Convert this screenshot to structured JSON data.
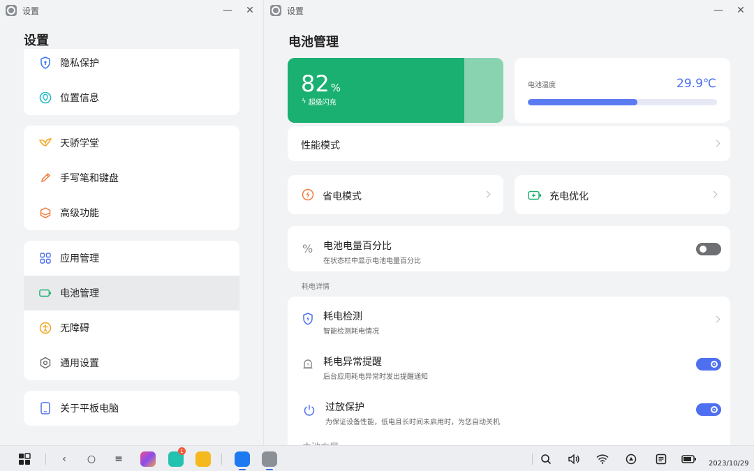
{
  "left_window": {
    "title": "设置",
    "page_title": "设置",
    "groups": [
      {
        "items": [
          {
            "label": "隐私保护",
            "icon": "shield-icon"
          },
          {
            "label": "位置信息",
            "icon": "location-icon"
          }
        ]
      },
      {
        "items": [
          {
            "label": "天骄学堂",
            "icon": "bird-icon"
          },
          {
            "label": "手写笔和键盘",
            "icon": "pen-icon"
          },
          {
            "label": "高级功能",
            "icon": "cube-icon"
          }
        ]
      },
      {
        "items": [
          {
            "label": "应用管理",
            "icon": "apps-grid-icon"
          },
          {
            "label": "电池管理",
            "icon": "battery-icon",
            "selected": true
          },
          {
            "label": "无障碍",
            "icon": "accessibility-icon"
          },
          {
            "label": "通用设置",
            "icon": "gear-icon"
          }
        ]
      },
      {
        "items": [
          {
            "label": "关于平板电脑",
            "icon": "tablet-icon"
          }
        ]
      }
    ]
  },
  "right_window": {
    "title": "设置",
    "page_title": "电池管理",
    "battery": {
      "percent_value": "82",
      "percent_unit": "%",
      "level": 0.82,
      "charging_label": "超级闪充",
      "accent": "#1ab071"
    },
    "temperature": {
      "label": "电池温度",
      "value": "29.9℃",
      "level": 0.58,
      "bar_color": "#5b7cf0"
    },
    "performance_mode": "性能模式",
    "power_save": "省电模式",
    "charge_optimize": "充电优化",
    "battery_percent": {
      "title": "电池电量百分比",
      "subtitle": "在状态栏中显示电池电量百分比",
      "enabled": false
    },
    "section_label": "耗电详情",
    "power_detect": {
      "title": "耗电检测",
      "subtitle": "智能检测耗电情况"
    },
    "abnormal_alert": {
      "title": "耗电异常提醒",
      "subtitle": "后台应用耗电异常时发出提醒通知",
      "enabled": true
    },
    "over_discharge": {
      "title": "过放保护",
      "subtitle": "为保证设备性能，低电且长时间未启用时，为您自动关机",
      "enabled": true
    },
    "cut_off_text": "主池方展"
  },
  "taskbar": {
    "date": "2023/10/29",
    "notification_badge": "1",
    "icons": [
      "grid-icon",
      "back-icon",
      "home-icon",
      "menu-icon",
      "gallery-app-icon",
      "store-app-icon",
      "files-app-icon",
      "photos-app-icon",
      "settings-app-icon",
      "search-icon",
      "volume-icon",
      "wifi-icon",
      "circle-up-icon",
      "notes-icon",
      "battery-status-icon"
    ]
  }
}
